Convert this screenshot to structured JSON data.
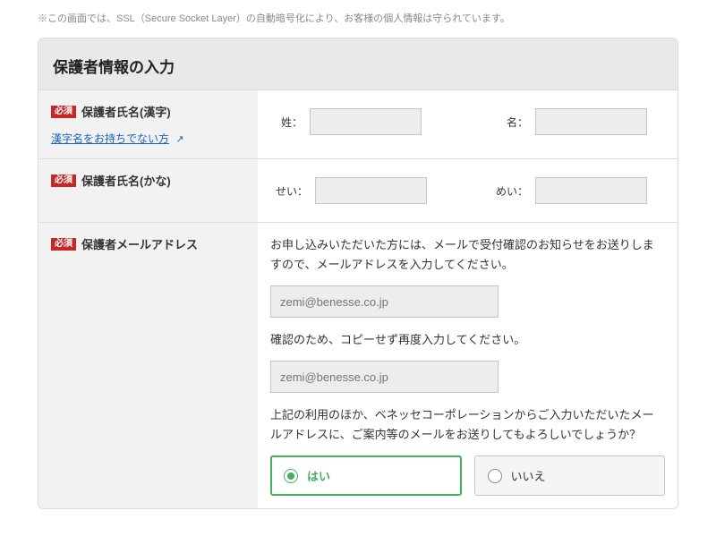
{
  "ssl_notice": "※この画面では、SSL（Secure Socket Layer）の自動暗号化により、お客様の個人情報は守られています。",
  "section": {
    "title": "保護者情報の入力",
    "required_label": "必須",
    "rows": {
      "name_kanji": {
        "label": "保護者氏名(漢字)",
        "sublink_text": "漢字名をお持ちでない方",
        "sei_label": "姓：",
        "mei_label": "名："
      },
      "name_kana": {
        "label": "保護者氏名(かな)",
        "sei_label": "せい：",
        "mei_label": "めい："
      },
      "email": {
        "label": "保護者メールアドレス",
        "help1": "お申し込みいただいた方には、メールで受付確認のお知らせをお送りしますので、メールアドレスを入力してください。",
        "placeholder1": "zemi@benesse.co.jp",
        "help2": "確認のため、コピーせず再度入力してください。",
        "placeholder2": "zemi@benesse.co.jp",
        "help3": "上記の利用のほか、ベネッセコーポレーションからご入力いただいたメールアドレスに、ご案内等のメールをお送りしてもよろしいでしょうか？",
        "opt_yes": "はい",
        "opt_no": "いいえ"
      }
    }
  }
}
